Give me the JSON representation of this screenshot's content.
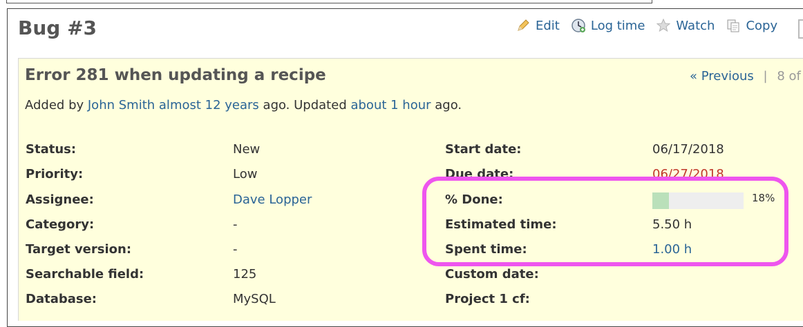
{
  "issue": {
    "title": "Bug #3",
    "subject": "Error 281 when updating a recipe",
    "author_prefix": "Added by ",
    "author": "John Smith",
    "created": "almost 12 years",
    "mid_text": " ago. Updated ",
    "updated": "about 1 hour",
    "suffix": " ago."
  },
  "contextual": {
    "edit": "Edit",
    "log_time": "Log time",
    "watch": "Watch",
    "copy": "Copy"
  },
  "nav": {
    "previous": "« Previous",
    "separator": "|",
    "position": "8 of"
  },
  "left_attributes": [
    {
      "label": "Status:",
      "value": "New"
    },
    {
      "label": "Priority:",
      "value": "Low"
    },
    {
      "label": "Assignee:",
      "value": "Dave Lopper"
    },
    {
      "label": "Category:",
      "value": "-"
    },
    {
      "label": "Target version:",
      "value": "-"
    },
    {
      "label": "Searchable field:",
      "value": "125"
    },
    {
      "label": "Database:",
      "value": "MySQL"
    }
  ],
  "right_attributes": [
    {
      "label": "Start date:",
      "value": "06/17/2018"
    },
    {
      "label": "Due date:",
      "value": "06/27/2018"
    },
    {
      "label": "% Done:",
      "value": "18%"
    },
    {
      "label": "Estimated time:",
      "value": "5.50 h"
    },
    {
      "label": "Spent time:",
      "value": "1.00 h"
    },
    {
      "label": "Custom date:",
      "value": ""
    },
    {
      "label": "Project 1 cf:",
      "value": ""
    }
  ],
  "done_ratio": 0.18,
  "colors": {
    "link": "#2a6496",
    "overdue": "#c0392b",
    "highlight": "#ee55ee",
    "issue_bg": "#ffffdd",
    "progress_fill": "#bae0ba"
  }
}
